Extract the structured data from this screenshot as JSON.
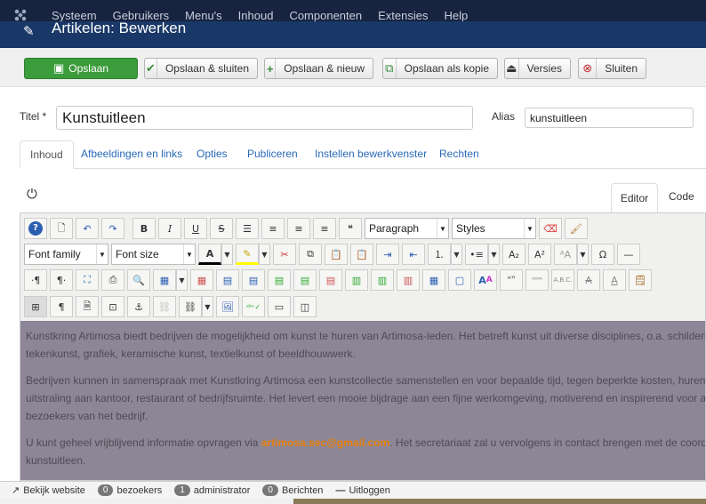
{
  "topnav": {
    "logo_icon": "joomla-logo-icon",
    "items": [
      "Systeem",
      "Gebruikers",
      "Menu's",
      "Inhoud",
      "Componenten",
      "Extensies",
      "Help"
    ]
  },
  "titlebar": {
    "icon": "pencil-icon",
    "title": "Artikelen: Bewerken"
  },
  "toolbar": {
    "save": "Opslaan",
    "save_close": "Opslaan & sluiten",
    "save_new": "Opslaan & nieuw",
    "save_copy": "Opslaan als kopie",
    "versions": "Versies",
    "close": "Sluiten"
  },
  "form": {
    "title_label": "Titel *",
    "title_value": "Kunstuitleen",
    "alias_label": "Alias",
    "alias_value": "kunstuitleen"
  },
  "tabs": [
    "Inhoud",
    "Afbeeldingen en links",
    "Opties",
    "Publiceren",
    "Instellen bewerkvenster",
    "Rechten"
  ],
  "editor": {
    "tabs": [
      "Editor",
      "Code"
    ],
    "format_select": "Paragraph",
    "styles_select": "Styles",
    "font_family_select": "Font family",
    "font_size_select": "Font size",
    "paragraphs": [
      [
        "Kunstkring Artimosa biedt bedrijven de mogelijkheid om kunst te huren van Artimosa-leden. Het betreft kunst uit diverse disciplines, o.a. schilderkunst,",
        "tekenkunst, grafiek, keramische kunst, textielkunst of beeldhouwwerk."
      ],
      [
        "Bedrijven kunnen in samenspraak met Kunstkring Artimosa een kunstcollectie samenstellen en voor bepaalde tijd, tegen beperkte kosten, huren. Kunst geeft",
        "uitstraling aan kantoor, restaurant of bedrijfsruimte. Het levert een mooie bijdrage aan een fijne werkomgeving, motiverend en inspirerend voor alle medewerkers",
        "bezoekers van het bedrijf."
      ]
    ],
    "p3_before": "U kunt geheel vrijblijvend informatie opvragen via ",
    "p3_email": "artimosa.sec@gmail.com",
    "p3_after": ". Het secretariaat zal u vervolgens in contact brengen met de coordinator van de",
    "p3_line2": "kunstuitleen."
  },
  "status": {
    "view_site": "Bekijk website",
    "visitors_count": "0",
    "visitors_label": "bezoekers",
    "admins_count": "1",
    "admins_label": "administrator",
    "messages_count": "0",
    "messages_label": "Berichten",
    "logout": "Uitloggen"
  }
}
